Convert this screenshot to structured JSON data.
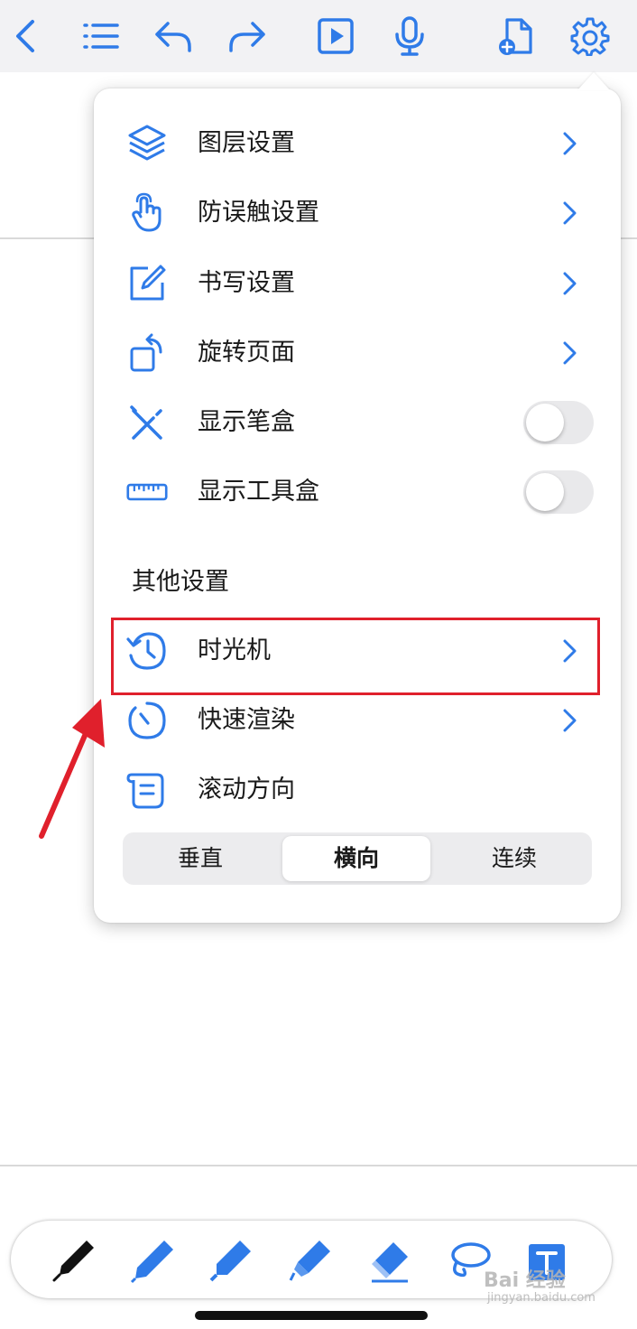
{
  "topbar": {
    "icons": [
      "back-chevron-icon",
      "list-icon",
      "undo-icon",
      "redo-icon",
      "play-icon",
      "microphone-icon",
      "add-page-icon",
      "settings-gear-icon"
    ]
  },
  "menu": {
    "items": [
      {
        "label": "图层设置",
        "icon": "layers-icon",
        "control": "chevron"
      },
      {
        "label": "防误触设置",
        "icon": "hand-touch-icon",
        "control": "chevron"
      },
      {
        "label": "书写设置",
        "icon": "edit-square-icon",
        "control": "chevron"
      },
      {
        "label": "旋转页面",
        "icon": "rotate-page-icon",
        "control": "chevron"
      },
      {
        "label": "显示笔盒",
        "icon": "pencil-box-icon",
        "control": "toggle",
        "on": false
      },
      {
        "label": "显示工具盒",
        "icon": "ruler-icon",
        "control": "toggle",
        "on": false
      }
    ],
    "section_title": "其他设置",
    "other_items": [
      {
        "label": "时光机",
        "icon": "history-clock-icon",
        "control": "chevron"
      },
      {
        "label": "快速渲染",
        "icon": "timer-icon",
        "control": "chevron"
      },
      {
        "label": "滚动方向",
        "icon": "scroll-icon",
        "control": "none"
      }
    ],
    "scroll_segments": [
      "垂直",
      "横向",
      "连续"
    ],
    "scroll_selected": "横向"
  },
  "bottom_toolbar": {
    "tools": [
      "fountain-pen-icon",
      "pencil-icon",
      "marker-icon",
      "highlighter-icon",
      "eraser-icon",
      "lasso-icon",
      "text-box-icon"
    ]
  },
  "watermark": {
    "main": "Bai 经验",
    "sub": "jingyan.baidu.com"
  },
  "colors": {
    "accent": "#2f7be8",
    "highlight": "#e0202c",
    "toggle_off": "#e9e9eb"
  }
}
